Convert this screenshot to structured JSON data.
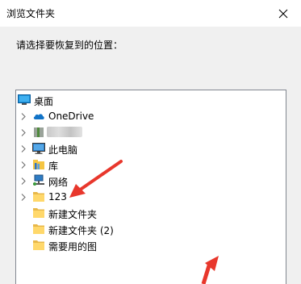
{
  "window": {
    "title": "浏览文件夹",
    "instruction": "请选择要恢复到的位置："
  },
  "tree": {
    "items": [
      {
        "label": "桌面",
        "icon": "desktop-icon",
        "expandable": false,
        "indent": 0
      },
      {
        "label": "OneDrive",
        "icon": "onedrive-icon",
        "expandable": true,
        "indent": 1
      },
      {
        "label": "",
        "icon": "user-folder-icon",
        "expandable": true,
        "indent": 1
      },
      {
        "label": "此电脑",
        "icon": "this-pc-icon",
        "expandable": true,
        "indent": 1
      },
      {
        "label": "库",
        "icon": "libraries-icon",
        "expandable": true,
        "indent": 1
      },
      {
        "label": "网络",
        "icon": "network-icon",
        "expandable": true,
        "indent": 1
      },
      {
        "label": "123",
        "icon": "folder-icon",
        "expandable": true,
        "indent": 1
      },
      {
        "label": "新建文件夹",
        "icon": "folder-icon",
        "expandable": false,
        "indent": 1
      },
      {
        "label": "新建文件夹 (2)",
        "icon": "folder-icon",
        "expandable": false,
        "indent": 1
      },
      {
        "label": "需要用的图",
        "icon": "folder-icon",
        "expandable": false,
        "indent": 1
      }
    ]
  },
  "colors": {
    "arrow": "#e8372c",
    "folder": "#ffd86b",
    "selection_border": "#828790"
  }
}
